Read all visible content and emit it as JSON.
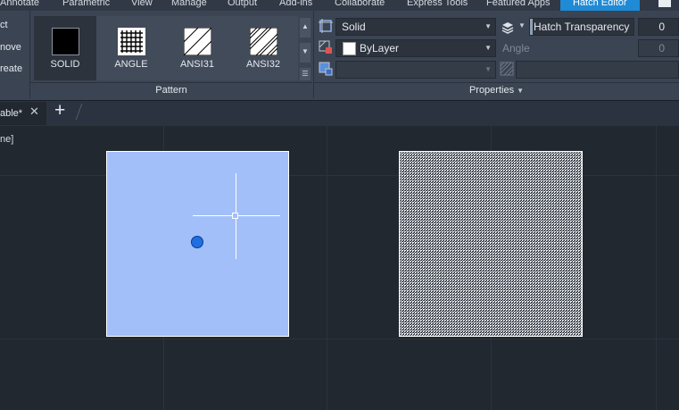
{
  "menu": {
    "items": [
      "Annotate",
      "Parametric",
      "View",
      "Manage",
      "Output",
      "Add-ins",
      "Collaborate",
      "Express Tools",
      "Featured Apps",
      "Hatch Editor"
    ],
    "active": "Hatch Editor"
  },
  "left_panel": {
    "labels": [
      "ct",
      "nove",
      "reate"
    ]
  },
  "pattern_panel": {
    "title": "Pattern",
    "swatches": [
      {
        "label": "SOLID",
        "icon": "solid-fill-icon",
        "selected": true
      },
      {
        "label": "ANGLE",
        "icon": "angle-grid-icon",
        "selected": false
      },
      {
        "label": "ANSI31",
        "icon": "ansi31-hatch-icon",
        "selected": false
      },
      {
        "label": "ANSI32",
        "icon": "ansi32-hatch-icon",
        "selected": false
      }
    ]
  },
  "properties_panel": {
    "title": "Properties",
    "hatch_type": "Solid",
    "color": "ByLayer",
    "background_color": "",
    "hatch_transparency_label": "Hatch Transparency",
    "hatch_transparency_value": "0",
    "angle_label": "Angle",
    "angle_value": "0",
    "scale_value": ""
  },
  "tabs": {
    "doc_tab_label": "able*",
    "add_tab_label": "+"
  },
  "canvas": {
    "command_text": "ne]",
    "solid_fill_color": "#a3bff9",
    "grip_color": "#1f6fe0",
    "dense_hatch_color": "#ffffff"
  }
}
